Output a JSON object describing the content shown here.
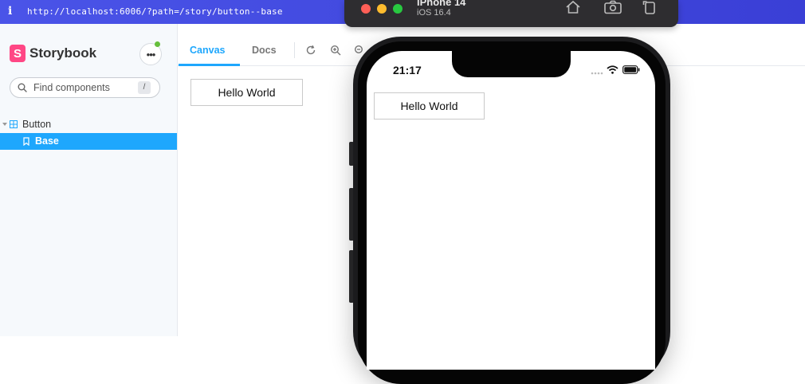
{
  "browser": {
    "info_icon": "i",
    "url": "http://localhost:6006/?path=/story/button--base"
  },
  "sidebar": {
    "brand": "Storybook",
    "brand_mark": "S",
    "menu_icon": "•••",
    "search": {
      "placeholder": "Find components",
      "shortcut": "/"
    },
    "tree": [
      {
        "type": "component",
        "label": "Button",
        "expanded": true
      },
      {
        "type": "story",
        "label": "Base",
        "selected": true
      }
    ]
  },
  "toolbar": {
    "tabs": [
      {
        "label": "Canvas",
        "active": true
      },
      {
        "label": "Docs",
        "active": false
      }
    ],
    "icons": [
      "reload-icon",
      "zoom-in-icon",
      "zoom-out-icon"
    ]
  },
  "canvas": {
    "button_label": "Hello World"
  },
  "simulator": {
    "device_name": "iPhone 14",
    "os_version": "iOS 16.4",
    "status_time": "21:17",
    "button_label": "Hello World",
    "icons": [
      "home-icon",
      "screenshot-icon",
      "rotate-icon"
    ]
  },
  "colors": {
    "accent": "#1ea7fd",
    "brand": "#ff4785",
    "url_bar": "#4a54e8",
    "status_dot": "#66bf3c"
  }
}
